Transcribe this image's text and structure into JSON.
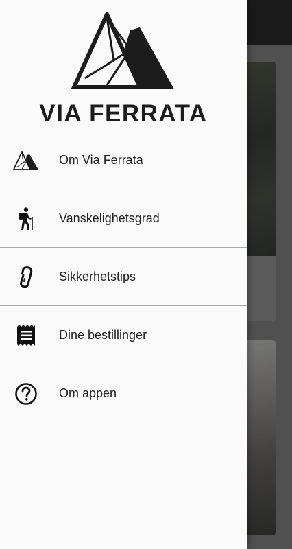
{
  "brand": {
    "title": "VIA FERRATA",
    "logo_icon": "mountain-logo"
  },
  "menu": {
    "items": [
      {
        "label": "Om Via Ferrata",
        "icon": "mountain-icon"
      },
      {
        "label": "Vanskelighetsgrad",
        "icon": "hiker-icon"
      },
      {
        "label": "Sikkerhetstips",
        "icon": "carabiner-icon"
      },
      {
        "label": "Dine bestillinger",
        "icon": "receipt-icon"
      },
      {
        "label": "Om appen",
        "icon": "help-circle-icon"
      }
    ]
  },
  "colors": {
    "drawer_background": "#fafafa",
    "text": "#212121",
    "divider": "#a8a8a8",
    "app_bar": "#1f1f1f"
  }
}
